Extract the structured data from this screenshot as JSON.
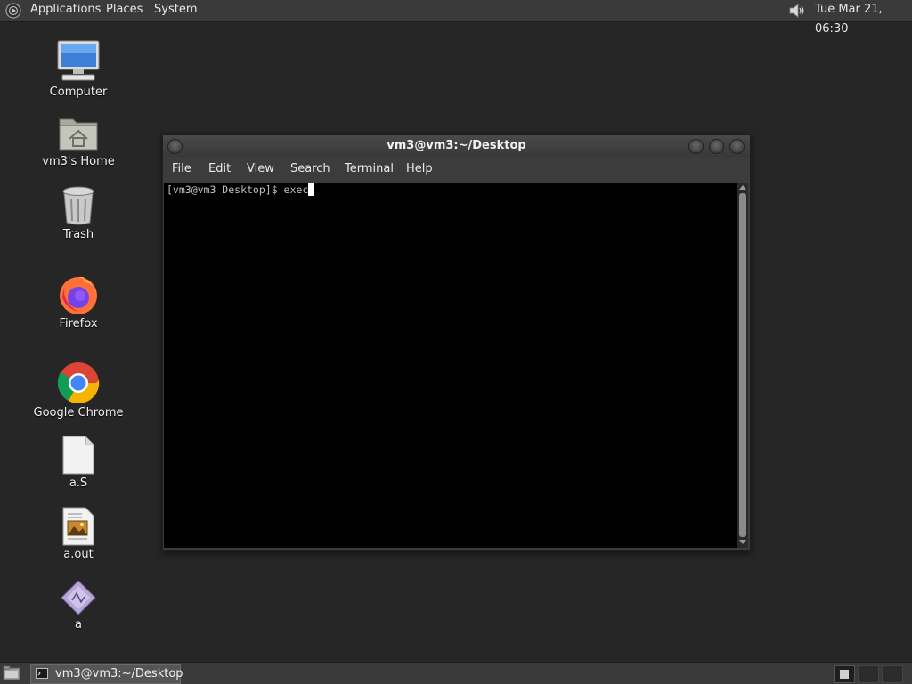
{
  "top_panel": {
    "applications": "Applications",
    "places": "Places",
    "system": "System",
    "clock": "Tue Mar 21, 06:30"
  },
  "desktop": {
    "icons": [
      {
        "label": "Computer",
        "icon": "computer-icon"
      },
      {
        "label": "vm3's Home",
        "icon": "home-folder-icon"
      },
      {
        "label": "Trash",
        "icon": "trash-icon"
      },
      {
        "label": "Firefox",
        "icon": "firefox-icon"
      },
      {
        "label": "Google Chrome",
        "icon": "chrome-icon"
      },
      {
        "label": "a.S",
        "icon": "text-file-icon"
      },
      {
        "label": "a.out",
        "icon": "executable-file-icon"
      },
      {
        "label": "a",
        "icon": "binary-file-icon"
      }
    ]
  },
  "terminal": {
    "title": "vm3@vm3:~/Desktop",
    "menu": [
      "File",
      "Edit",
      "View",
      "Search",
      "Terminal",
      "Help"
    ],
    "prompt": "[vm3@vm3 Desktop]$ exec"
  },
  "taskbar": {
    "task_label": "vm3@vm3:~/Desktop"
  },
  "colors": {
    "desktop_bg": "#262626",
    "panel_bg": "#3a3a3a",
    "terminal_bg": "#000000"
  }
}
